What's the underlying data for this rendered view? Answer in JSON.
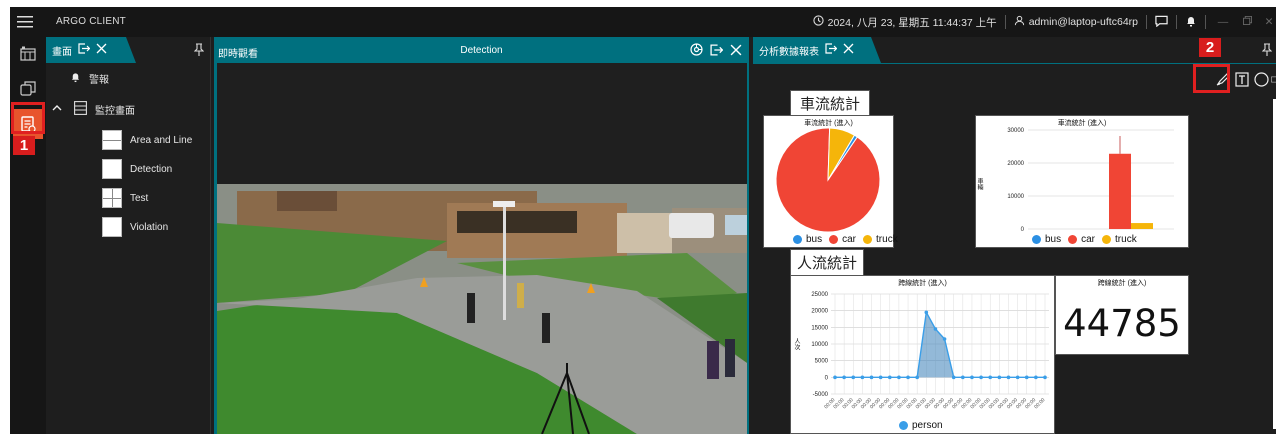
{
  "titlebar": {
    "app_title": "ARGO CLIENT",
    "datetime": "2024, 八月 23, 星期五 11:44:37 上午",
    "user": "admin@laptop-uftc64rp"
  },
  "annotations": {
    "label1": "1",
    "label2": "2"
  },
  "panel_screens": {
    "tab_label": "畫面",
    "alarm_label": "警報",
    "group_label": "監控畫面",
    "items": [
      {
        "label": "Area and Line",
        "icon": "two-horizontal-split-icon"
      },
      {
        "label": "Detection",
        "icon": "single-view-icon"
      },
      {
        "label": "Test",
        "icon": "four-grid-icon"
      },
      {
        "label": "Violation",
        "icon": "single-view-icon"
      }
    ]
  },
  "panel_live": {
    "tab_label": "即時觀看",
    "view_title": "Detection"
  },
  "panel_report": {
    "tab_label": "分析數據報表",
    "vehicle_section": "車流統計",
    "people_section": "人流統計",
    "pie_title": "車流統計 (進入)",
    "bar_title": "車流統計 (進入)",
    "bar_ylabel": "車輛",
    "line_title": "跨線統計 (進入)",
    "line_ylabel": "人次",
    "counter_title": "跨線統計 (進入)",
    "counter_value": "44785",
    "vehicle_legend": [
      "bus",
      "car",
      "truck"
    ],
    "people_legend": [
      "person"
    ]
  },
  "colors": {
    "accent": "#00707f",
    "active": "#e8542c",
    "bus": "#2b8fe3",
    "car": "#f04535",
    "truck": "#f5b50a",
    "person": "#3a9ee8"
  },
  "chart_data": [
    {
      "type": "pie",
      "title": "車流統計 (進入)",
      "categories": [
        "bus",
        "car",
        "truck"
      ],
      "values": [
        1,
        91,
        8
      ]
    },
    {
      "type": "bar",
      "title": "車流統計 (進入)",
      "ylabel": "車輛",
      "series": [
        {
          "name": "bus",
          "values": [
            0
          ]
        },
        {
          "name": "car",
          "values": [
            22800
          ]
        },
        {
          "name": "truck",
          "values": [
            1800
          ]
        }
      ],
      "ylim": [
        0,
        30000
      ],
      "yticks": [
        0,
        10000,
        20000,
        30000
      ]
    },
    {
      "type": "area",
      "title": "跨線統計 (進入)",
      "ylabel": "人次",
      "series": [
        {
          "name": "person",
          "values": [
            0,
            0,
            0,
            0,
            0,
            0,
            0,
            0,
            0,
            0,
            19500,
            14500,
            11500,
            0,
            0,
            0,
            0,
            0,
            0,
            0,
            0,
            0,
            0,
            0
          ]
        }
      ],
      "ylim": [
        -5000,
        25000
      ],
      "yticks": [
        -5000,
        0,
        5000,
        10000,
        15000,
        20000,
        25000
      ]
    },
    {
      "type": "table",
      "title": "跨線統計 (進入)",
      "values": [
        44785
      ]
    }
  ]
}
